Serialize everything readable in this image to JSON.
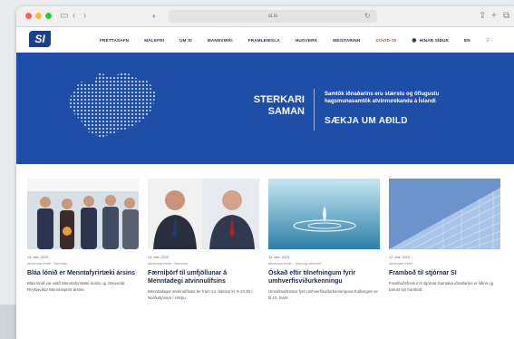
{
  "browser": {
    "address": "si.is"
  },
  "nav": {
    "logo": "SI",
    "items": [
      "FRÉTTASAFN",
      "MÁLEFNI",
      "UM SI",
      "MANNVIRKI",
      "FRAMLEIÐSLA",
      "HUGVERK",
      "MEISTARINN",
      "COVID-19",
      "HINAR SÍÐUR",
      "EN"
    ],
    "covid_color": "#d9362b"
  },
  "hero": {
    "line1": "STERKARI",
    "line2": "SAMAN",
    "description": "Samtök iðnaðarins eru stærstu og öflugustu hagsmunasamtök atvinnurekanda á Íslandi",
    "cta": "SÆKJA UM AÐILD",
    "bg_color": "#1f4ea8"
  },
  "cards": [
    {
      "date": "15. des. 2023",
      "meta": "Almennar fréttir · Menntun",
      "title": "Bláa lónið er Menntafyrirtæki ársins",
      "body": "Bláa lónið var valið Menntafyrirtæki ársins og Orkuveita Reykjavíkur Menntasproti ársins."
    },
    {
      "date": "14. des. 2023",
      "meta": "Almennar fréttir · Menntun",
      "title": "Færniþörf til umfjöllunar á Menntadegi atvinnulífsins",
      "body": "Menntadagur atvinnulífsins fer fram 14. febrúar kl. 9-10.30 í Norðurljósum í Hörpu."
    },
    {
      "date": "13. des. 2023",
      "meta": "Almennar fréttir · Orka og umhverfi",
      "title": "Óskað eftir tilnefningum fyrir umhverfisviðurkenningu",
      "body": "Umsóknarfrestur fyrir umhverfisviðurkenninguna Kuðunginn er til 10. mars."
    },
    {
      "date": "12. des. 2023",
      "meta": "Almennar fréttir",
      "title": "Framboð til stjórnar SI",
      "body": "Framboðsfrestur til stjórnar Samtaka iðnaðarins er liðinn og barust sjö framboð."
    }
  ]
}
